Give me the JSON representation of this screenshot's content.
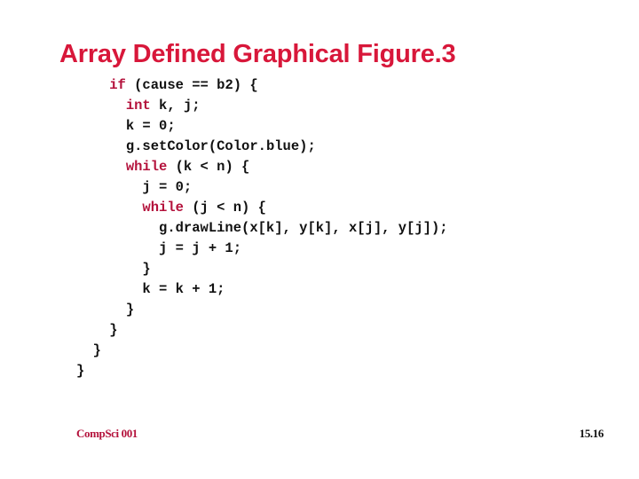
{
  "slide": {
    "title": "Array Defined Graphical Figure.3",
    "title_color": "#d8173a",
    "keyword_color": "#b4123c",
    "code_lines": [
      {
        "indent": 2,
        "keyword": "if",
        "rest": " (cause == b2) {"
      },
      {
        "indent": 3,
        "keyword": "int",
        "rest": " k, j;"
      },
      {
        "indent": 3,
        "keyword": "",
        "rest": "k = 0;"
      },
      {
        "indent": 3,
        "keyword": "",
        "rest": "g.setColor(Color.blue);"
      },
      {
        "indent": 3,
        "keyword": "while",
        "rest": " (k < n) {"
      },
      {
        "indent": 4,
        "keyword": "",
        "rest": "j = 0;"
      },
      {
        "indent": 4,
        "keyword": "while",
        "rest": " (j < n) {"
      },
      {
        "indent": 5,
        "keyword": "",
        "rest": "g.drawLine(x[k], y[k], x[j], y[j]);"
      },
      {
        "indent": 5,
        "keyword": "",
        "rest": "j = j + 1;"
      },
      {
        "indent": 4,
        "keyword": "",
        "rest": "}"
      },
      {
        "indent": 4,
        "keyword": "",
        "rest": "k = k + 1;"
      },
      {
        "indent": 3,
        "keyword": "",
        "rest": "}"
      },
      {
        "indent": 2,
        "keyword": "",
        "rest": "}"
      },
      {
        "indent": 1,
        "keyword": "",
        "rest": "}"
      },
      {
        "indent": 0,
        "keyword": "",
        "rest": "}"
      }
    ]
  },
  "footer": {
    "course": "CompSci 001",
    "page_number": "15.16"
  }
}
